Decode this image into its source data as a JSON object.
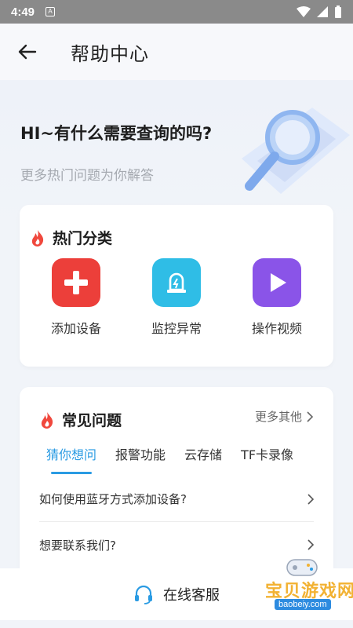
{
  "status_bar": {
    "time": "4:49",
    "notification_icon": "a-box-icon"
  },
  "header": {
    "title": "帮助中心"
  },
  "hero": {
    "title": "HI~有什么需要查询的吗?",
    "subtitle": "更多热门问题为你解答"
  },
  "hot_categories": {
    "title": "热门分类",
    "items": [
      {
        "label": "添加设备",
        "icon": "plus-icon",
        "color": "#ec3f3a"
      },
      {
        "label": "监控异常",
        "icon": "alarm-light-icon",
        "color": "#2fbde6"
      },
      {
        "label": "操作视频",
        "icon": "play-icon",
        "color": "#8a54e8"
      }
    ]
  },
  "faq": {
    "title": "常见问题",
    "more": "更多其他",
    "tabs": [
      {
        "label": "猜你想问",
        "active": true
      },
      {
        "label": "报警功能",
        "active": false
      },
      {
        "label": "云存储",
        "active": false
      },
      {
        "label": "TF卡录像",
        "active": false
      }
    ],
    "questions": [
      {
        "text": "如何使用蓝牙方式添加设备?"
      },
      {
        "text": "想要联系我们?"
      }
    ]
  },
  "bottom_bar": {
    "label": "在线客服"
  },
  "watermark": {
    "text": "宝贝游戏网",
    "url": "baobeiy.com"
  },
  "colors": {
    "accent": "#2a9be3",
    "fire": "#f0483d"
  }
}
